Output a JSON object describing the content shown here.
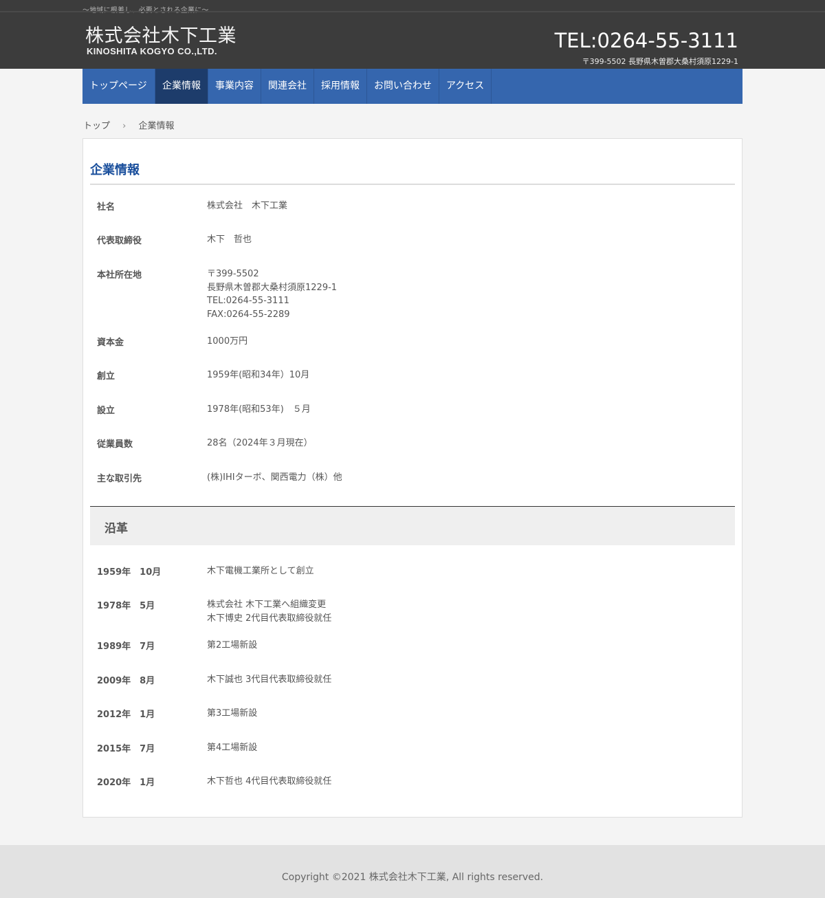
{
  "header": {
    "tagline": "〜地域に根差し、必要とされる企業に〜",
    "logo_jp": "株式会社木下工業",
    "logo_en": "KINOSHITA KOGYO CO.,LTD.",
    "tel": "TEL:0264-55-3111",
    "address": "〒399-5502 長野県木曽郡大桑村須原1229-1"
  },
  "nav": {
    "items": [
      "トップページ",
      "企業情報",
      "事業内容",
      "関連会社",
      "採用情報",
      "お問い合わせ",
      "アクセス"
    ],
    "active": "企業情報"
  },
  "breadcrumb": {
    "home": "トップ",
    "separator": "›",
    "current": "企業情報"
  },
  "page": {
    "title": "企業情報",
    "history_title": "沿革"
  },
  "company": [
    {
      "label": "社名",
      "value": [
        "株式会社　木下工業"
      ]
    },
    {
      "label": "代表取締役",
      "value": [
        "木下　哲也"
      ]
    },
    {
      "label": "本社所在地",
      "value": [
        "〒399-5502",
        "長野県木曽郡大桑村須原1229-1",
        "TEL:0264-55-3111",
        "FAX:0264-55-2289"
      ]
    },
    {
      "label": "資本金",
      "value": [
        "1000万円"
      ]
    },
    {
      "label": "創立",
      "value": [
        "1959年(昭和34年）10月"
      ]
    },
    {
      "label": "設立",
      "value": [
        "1978年(昭和53年)　５月"
      ]
    },
    {
      "label": "従業員数",
      "value": [
        "28名（2024年３月現在）"
      ]
    },
    {
      "label": "主な取引先",
      "value": [
        "(株)IHIターボ、関西電力（株）他"
      ]
    }
  ],
  "history": [
    {
      "label": "1959年　10月",
      "value": [
        "木下電機工業所として創立"
      ]
    },
    {
      "label": "1978年　5月",
      "value": [
        "株式会社 木下工業へ組織変更",
        "木下博史 2代目代表取締役就任"
      ]
    },
    {
      "label": "1989年　7月",
      "value": [
        "第2工場新設"
      ]
    },
    {
      "label": "2009年　8月",
      "value": [
        "木下誠也 3代目代表取締役就任"
      ]
    },
    {
      "label": "2012年　1月",
      "value": [
        "第3工場新設"
      ]
    },
    {
      "label": "2015年　7月",
      "value": [
        "第4工場新設"
      ]
    },
    {
      "label": "2020年　1月",
      "value": [
        "木下哲也 4代目代表取締役就任"
      ]
    }
  ],
  "footer": {
    "copyright": "Copyright ©2021 株式会社木下工業, All rights reserved."
  },
  "colors": {
    "header_bg": "#3c3c3c",
    "nav_bg": "#3566ae",
    "nav_active": "#1d3c6b",
    "title": "#1a4f9c"
  }
}
